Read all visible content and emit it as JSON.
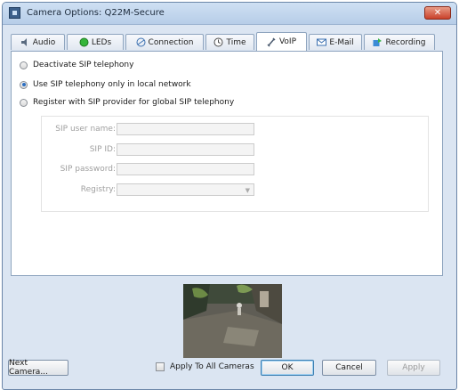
{
  "window": {
    "title": "Camera Options: Q22M-Secure",
    "close_label": "✕"
  },
  "tabs": [
    {
      "label": "Audio",
      "icon": "speaker-icon"
    },
    {
      "label": "LEDs",
      "icon": "led-icon"
    },
    {
      "label": "Connection",
      "icon": "connection-icon"
    },
    {
      "label": "Time",
      "icon": "clock-icon"
    },
    {
      "label": "VoIP",
      "icon": "phone-icon",
      "active": true
    },
    {
      "label": "E-Mail",
      "icon": "mail-icon"
    },
    {
      "label": "Recording",
      "icon": "recording-icon"
    }
  ],
  "options": {
    "deactivate": "Deactivate SIP telephony",
    "local": "Use SIP telephony only in local network",
    "register": "Register with SIP provider for global SIP telephony",
    "selected": "local"
  },
  "fields": {
    "user_name": "SIP user name:",
    "sip_id": "SIP ID:",
    "password": "SIP password:",
    "registry": "Registry:"
  },
  "footer": {
    "next_camera": "Next Camera...",
    "apply_all": "Apply To All Cameras",
    "ok": "OK",
    "cancel": "Cancel",
    "apply": "Apply"
  }
}
